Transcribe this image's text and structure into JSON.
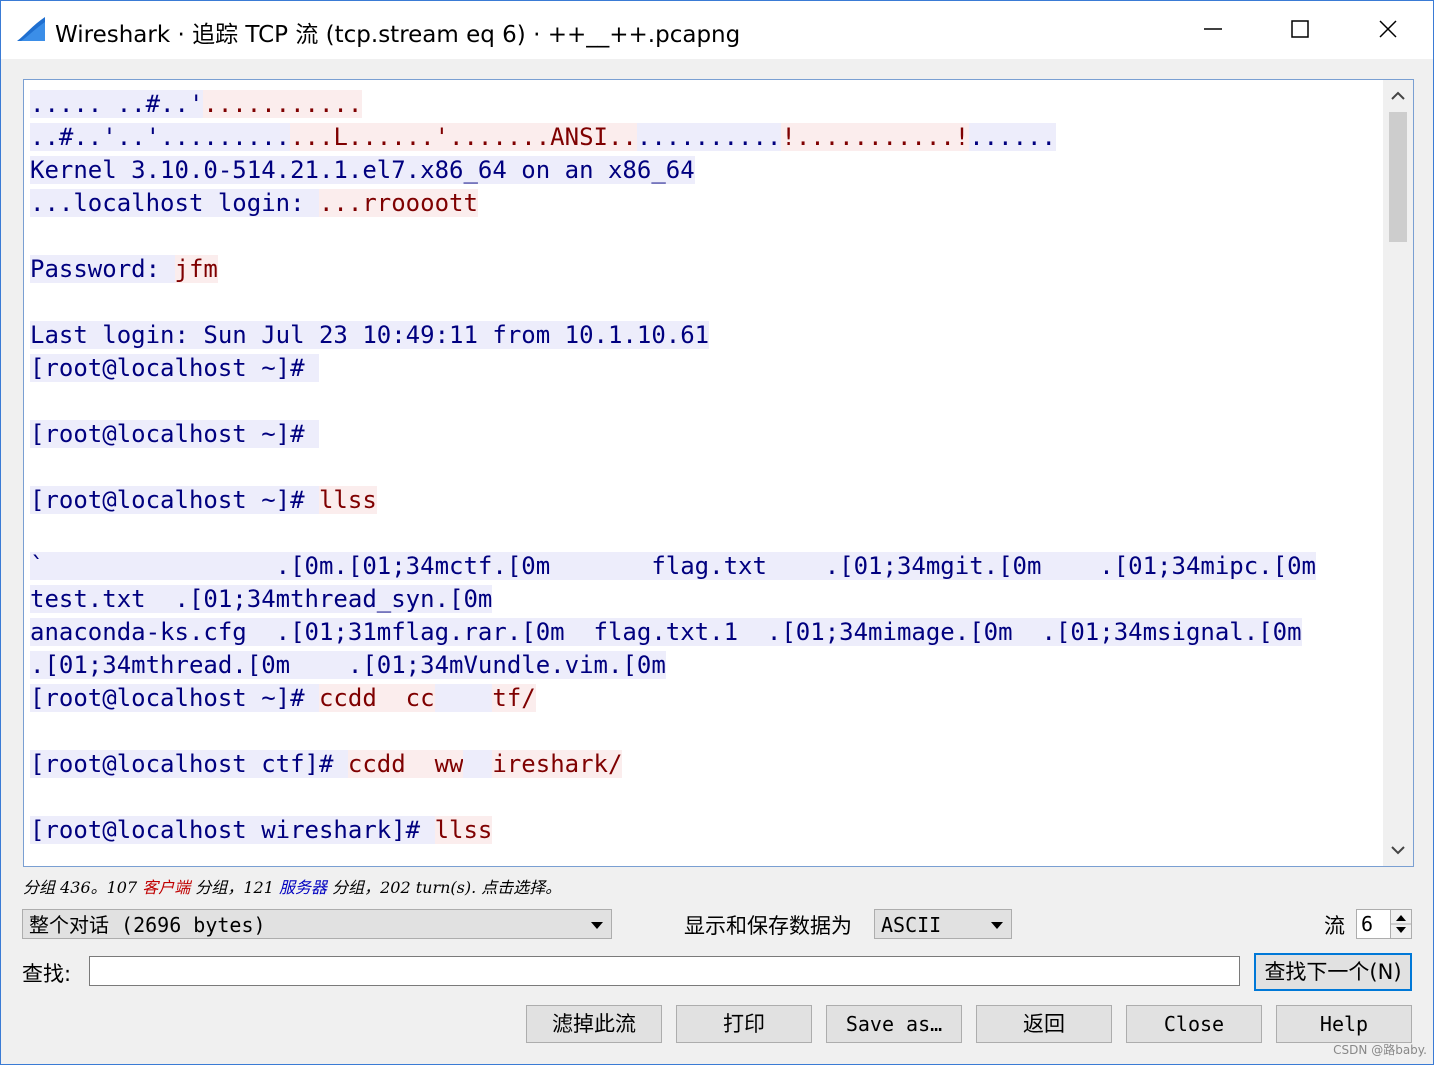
{
  "window": {
    "title": "Wireshark · 追踪 TCP 流 (tcp.stream eq 6) · ++__++.pcapng",
    "minimize_icon": "minimize-icon",
    "maximize_icon": "maximize-icon",
    "close_icon": "close-icon"
  },
  "stream": {
    "lines": [
      [
        {
          "t": "..... ..#..'",
          "k": "s"
        },
        {
          "t": "...........",
          "k": "c"
        }
      ],
      [
        {
          "t": "..#..'..'.........",
          "k": "s"
        },
        {
          "t": "...L......'.......ANSI..",
          "k": "c"
        },
        {
          "t": "..........",
          "k": "s"
        },
        {
          "t": "!...........!",
          "k": "c"
        },
        {
          "t": "......",
          "k": "s"
        }
      ],
      [
        {
          "t": "Kernel 3.10.0-514.21.1.el7.x86_64 on an x86_64",
          "k": "s"
        }
      ],
      [
        {
          "t": "...localhost login: ",
          "k": "s"
        },
        {
          "t": "...rroooott",
          "k": "c"
        }
      ],
      [],
      [
        {
          "t": "Password: ",
          "k": "s"
        },
        {
          "t": "jfm",
          "k": "c"
        }
      ],
      [],
      [
        {
          "t": "Last login: Sun Jul 23 10:49:11 from 10.1.10.61",
          "k": "s"
        }
      ],
      [
        {
          "t": "[root@localhost ~]# ",
          "k": "s"
        }
      ],
      [],
      [
        {
          "t": "[root@localhost ~]# ",
          "k": "s"
        }
      ],
      [],
      [
        {
          "t": "[root@localhost ~]# ",
          "k": "s"
        },
        {
          "t": "llss",
          "k": "c"
        }
      ],
      [],
      [
        {
          "t": "`                .[0m.[01;34mctf.[0m       flag.txt    .[01;34mgit.[0m    .[01;34mipc.[0m",
          "k": "s"
        }
      ],
      [
        {
          "t": "test.txt  .[01;34mthread_syn.[0m",
          "k": "s"
        }
      ],
      [
        {
          "t": "anaconda-ks.cfg  .[01;31mflag.rar.[0m  flag.txt.1  .[01;34mimage.[0m  .[01;34msignal.[0m",
          "k": "s"
        }
      ],
      [
        {
          "t": ".[01;34mthread.[0m    .[01;34mVundle.vim.[0m",
          "k": "s"
        }
      ],
      [
        {
          "t": "[root@localhost ~]# ",
          "k": "s"
        },
        {
          "t": "ccdd  cc",
          "k": "c"
        },
        {
          "t": "    ",
          "k": "s"
        },
        {
          "t": "tf/",
          "k": "c"
        }
      ],
      [],
      [
        {
          "t": "[root@localhost ctf]# ",
          "k": "s"
        },
        {
          "t": "ccdd  ww",
          "k": "c"
        },
        {
          "t": "  ",
          "k": "s"
        },
        {
          "t": "ireshark/",
          "k": "c"
        }
      ],
      [],
      [
        {
          "t": "[root@localhost wireshark]# ",
          "k": "s"
        },
        {
          "t": "llss",
          "k": "c"
        }
      ]
    ]
  },
  "summary": {
    "prefix": "分组 436。107 ",
    "client": "客户端",
    "middle": " 分组，121 ",
    "server": "服务器",
    "suffix": " 分组，202 turn(s). 点击选择。"
  },
  "controls": {
    "conversation_select": "整个对话 (2696 bytes)",
    "show_as_label": "显示和保存数据为",
    "show_as_select": "ASCII",
    "stream_label": "流",
    "stream_value": "6",
    "find_label": "查找:",
    "find_value": "",
    "find_next_button": "查找下一个(N)"
  },
  "buttons": {
    "filter_out": "滤掉此流",
    "print": "打印",
    "save_as": "Save as…",
    "back": "返回",
    "close": "Close",
    "help": "Help"
  },
  "watermark": "CSDN @路baby."
}
